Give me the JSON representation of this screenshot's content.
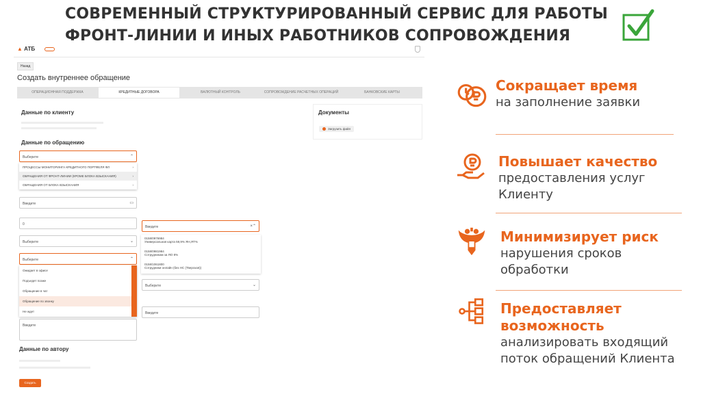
{
  "slide_title_line1": "СОВРЕМЕННЫЙ СТРУКТУРИРОВАННЫЙ СЕРВИС ДЛЯ РАБОТЫ",
  "slide_title_line2": "ФРОНТ-ЛИНИИ И ИНЫХ РАБОТНИКОВ СОПРОВОЖДЕНИЯ",
  "app": {
    "logo": "АТБ",
    "back_label": "Назад",
    "page_title": "Создать внутреннее обращение",
    "tabs": [
      "ОПЕРАЦИОННАЯ ПОДДЕРЖКА",
      "КРЕДИТНЫЕ ДОГОВОРА",
      "ВАЛЮТНЫЙ КОНТРОЛЬ",
      "СОПРОВОЖДЕНИЕ РАСЧЕТНЫХ ОПЕРАЦИЙ",
      "БАНКОВСКИЕ КАРТЫ"
    ],
    "client_header": "Данные по клиенту",
    "request_header": "Данные по обращению",
    "docs_header": "Документы",
    "upload_label": "Загрузить файл",
    "select_placeholder": "Выберите",
    "date_placeholder": "Введите",
    "number_value": "0",
    "request_options": [
      "ПРОЦЕССЫ МОНИТОРИНГА КРЕДИТНОГО ПОРТФЕЛЯ ФЛ",
      "ОБРАЩЕНИЯ ОТ ФРОНТ-ЛИНИИ (КРОМЕ БЛОКА ВЗЫСКАНИЯ)",
      "ОБРАЩЕНИЯ ОТ БЛОКА ВЗЫСКАНИЯ"
    ],
    "status_options": [
      "Ожидает в офисе",
      "Подъедет позже",
      "Обращение в чат",
      "Обращение по звонку",
      "Не ждет"
    ],
    "contract_options": [
      {
        "num": "0158/0976984",
        "desc": "Универсальная карта 59,9% ЯН,ЯТ%"
      },
      {
        "num": "0158/0981984",
        "desc": "Сотрудникам за ЯО 8%"
      },
      {
        "num": "0158/1061800",
        "desc": "Сотрудники онлайн (без НС (Тверская))"
      }
    ],
    "contract_placeholder": "Введите",
    "comment_placeholder": "Введите",
    "author_header": "Данные по автору",
    "submit_label": "Создать"
  },
  "benefits": [
    {
      "title": "Сокращает время",
      "subtitle": [
        "на заполнение заявки"
      ]
    },
    {
      "title": "Повышает качество",
      "subtitle": [
        "предоставления услуг",
        "Клиенту"
      ]
    },
    {
      "title": "Минимизирует риск",
      "subtitle": [
        "нарушения сроков",
        "обработки"
      ]
    },
    {
      "title": "Предоставляет",
      "title2": "возможность",
      "subtitle": [
        "анализировать входящий",
        "поток обращений Клиента"
      ]
    }
  ],
  "colors": {
    "accent": "#e8651e",
    "check": "#3aa53a",
    "title": "#333333"
  }
}
